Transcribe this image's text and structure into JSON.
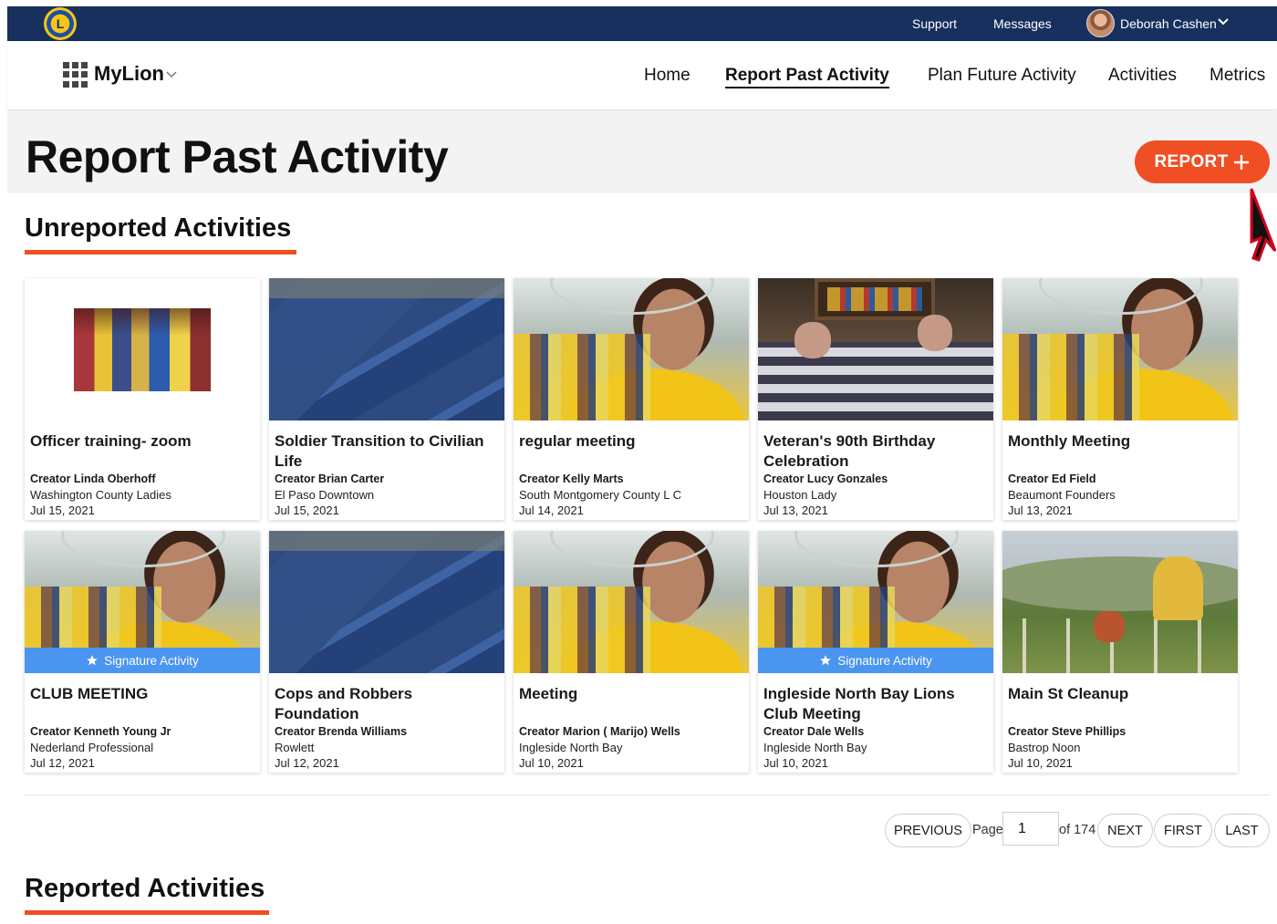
{
  "topbar": {
    "logo_text": "L",
    "support": "Support",
    "messages": "Messages",
    "username": "Deborah Cashen"
  },
  "nav": {
    "brand": "MyLion",
    "links": [
      "Home",
      "Report Past Activity",
      "Plan Future Activity",
      "Activities",
      "Metrics"
    ],
    "active": "Report Past Activity"
  },
  "page": {
    "title": "Report Past Activity",
    "report_button": "REPORT",
    "unreported_title": "Unreported Activities",
    "reported_title": "Reported Activities"
  },
  "cards": [
    {
      "title": "Officer training- zoom",
      "creator": "Creator Linda Oberhoff",
      "club": "Washington County Ladies",
      "date": "Jul 15, 2021",
      "image": "club-group-photo",
      "signature": ""
    },
    {
      "title": "Soldier Transition to Civilian Life",
      "creator": "Creator Brian Carter",
      "club": "El Paso Downtown",
      "date": "Jul 15, 2021",
      "image": "blue-tents",
      "signature": ""
    },
    {
      "title": "regular meeting",
      "creator": "Creator Kelly Marts",
      "club": "South Montgomery County L C",
      "date": "Jul 14, 2021",
      "image": "lions-member-portrait",
      "signature": ""
    },
    {
      "title": "Veteran's 90th Birthday Celebration",
      "creator": "Creator Lucy Gonzales",
      "club": "Houston Lady",
      "date": "Jul 13, 2021",
      "image": "framed-medals",
      "signature": ""
    },
    {
      "title": "Monthly Meeting",
      "creator": "Creator Ed Field",
      "club": "Beaumont Founders",
      "date": "Jul 13, 2021",
      "image": "lions-member-portrait",
      "signature": ""
    },
    {
      "title": "CLUB MEETING",
      "creator": "Creator Kenneth Young Jr",
      "club": "Nederland Professional",
      "date": "Jul 12, 2021",
      "image": "lions-member-portrait",
      "signature": "Signature Activity"
    },
    {
      "title": "Cops and Robbers Foundation",
      "creator": "Creator Brenda Williams",
      "club": "Rowlett",
      "date": "Jul 12, 2021",
      "image": "blue-tents",
      "signature": ""
    },
    {
      "title": "Meeting",
      "creator": "Creator Marion ( Marijo) Wells",
      "club": "Ingleside North Bay",
      "date": "Jul 10, 2021",
      "image": "lions-member-portrait",
      "signature": ""
    },
    {
      "title": "Ingleside North Bay Lions Club Meeting",
      "creator": "Creator Dale Wells",
      "club": "Ingleside North Bay",
      "date": "Jul 10, 2021",
      "image": "lions-member-portrait",
      "signature": "Signature Activity"
    },
    {
      "title": "Main St Cleanup",
      "creator": "Creator Steve Phillips",
      "club": "Bastrop Noon",
      "date": "Jul 10, 2021",
      "image": "hillside-cleanup",
      "signature": ""
    }
  ],
  "pagination": {
    "previous": "PREVIOUS",
    "page_label": "Page",
    "current_page": "1",
    "of_total": "of 174",
    "next": "NEXT",
    "first": "FIRST",
    "last": "LAST"
  },
  "colors": {
    "topbar": "#17305e",
    "accent": "#f04e23",
    "signature": "#4a95ef"
  }
}
